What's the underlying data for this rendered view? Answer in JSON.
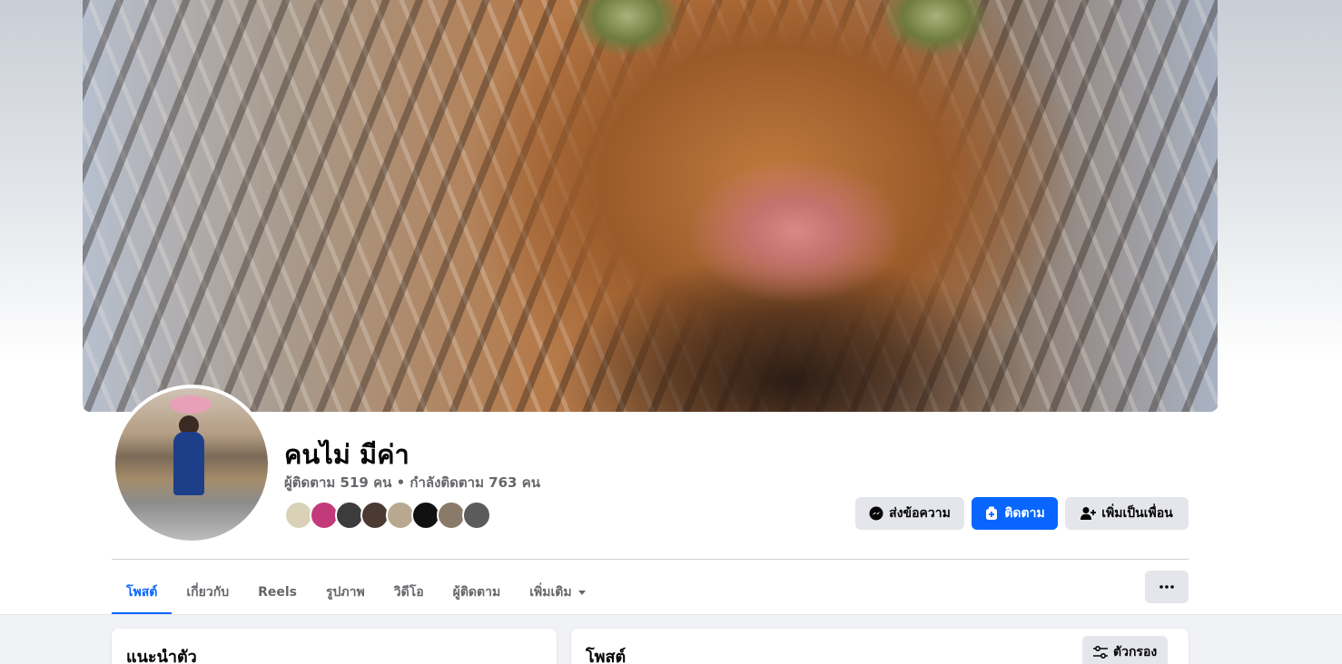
{
  "profile": {
    "name": "คนไม่ มีค่า",
    "stats": "ผู้ติดตาม 519 คน • กำลังติดตาม 763 คน"
  },
  "friend_avatar_colors": [
    "#d9d2b8",
    "#c33a7a",
    "#3c3c3c",
    "#4a3a32",
    "#b8a890",
    "#111111",
    "#8a7a6a",
    "#5b5b5b"
  ],
  "actions": {
    "message_label": "ส่งข้อความ",
    "follow_label": "ติดตาม",
    "add_friend_label": "เพิ่มเป็นเพื่อน"
  },
  "tabs": [
    {
      "label": "โพสต์",
      "active": true
    },
    {
      "label": "เกี่ยวกับ",
      "active": false
    },
    {
      "label": "Reels",
      "active": false
    },
    {
      "label": "รูปภาพ",
      "active": false
    },
    {
      "label": "วิดีโอ",
      "active": false
    },
    {
      "label": "ผู้ติดตาม",
      "active": false
    },
    {
      "label": "เพิ่มเติม",
      "active": false
    }
  ],
  "intro_card": {
    "title": "แนะนำตัว"
  },
  "posts_card": {
    "title": "โพสต์",
    "filter_label": "ตัวกรอง"
  },
  "colors": {
    "accent": "#0866ff",
    "button_gray": "#e4e6eb",
    "secondary_text": "#65676b",
    "page_bg": "#f0f2f5"
  },
  "icons": {
    "message": "messenger-icon",
    "follow": "follow-icon",
    "add_friend": "add-friend-icon",
    "more": "more-dots-icon",
    "filter": "filter-icon",
    "tab_more": "caret-down-icon"
  }
}
